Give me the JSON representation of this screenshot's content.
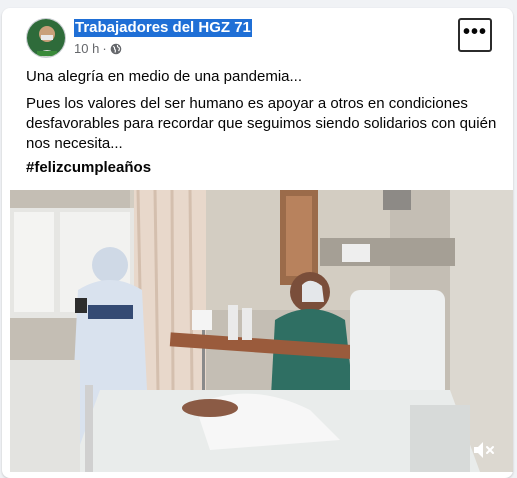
{
  "post": {
    "page_name": "Trabajadores del HGZ 71",
    "time": "10 h",
    "separator": "·",
    "audience_icon": "globe-icon",
    "more_icon": "more-horizontal-icon",
    "more_label": "•••",
    "line1": "Una alegría en medio de una pandemia...",
    "paragraph": "Pues los valores del ser humano es apoyar a otros en condiciones desfavorables para recordar que seguimos siendo solidarios con quién nos necesita...",
    "hashtag": "#felizcumpleaños"
  },
  "video": {
    "mute_icon": "volume-muted-icon"
  },
  "colors": {
    "page_name_highlight": "#1f6fd6",
    "text": "#050505",
    "meta": "#65676b",
    "background": "#f0f2f5"
  }
}
